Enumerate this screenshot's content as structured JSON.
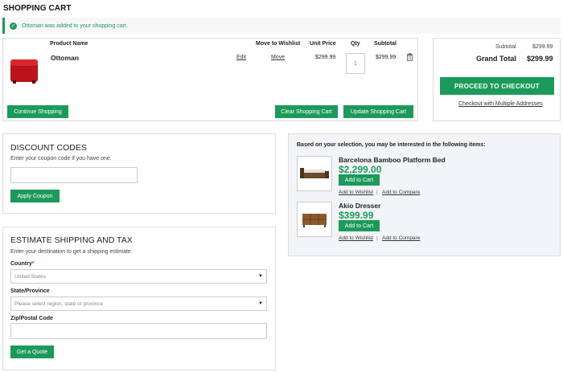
{
  "page": {
    "title": "SHOPPING CART"
  },
  "message": {
    "text": "Ottoman was added to your shopping cart."
  },
  "cart": {
    "headers": {
      "product_name": "Product Name",
      "move_to_wishlist": "Move to Wishlist",
      "unit_price": "Unit Price",
      "qty": "Qty",
      "subtotal": "Subtotal"
    },
    "items": [
      {
        "name": "Ottoman",
        "edit": "Edit",
        "move": "Move",
        "unit_price": "$299.99",
        "qty": "1",
        "subtotal": "$299.99"
      }
    ],
    "buttons": {
      "continue": "Continue Shopping",
      "clear": "Clear Shopping Cart",
      "update": "Update Shopping Cart"
    }
  },
  "summary": {
    "subtotal_label": "Subtotal",
    "subtotal_value": "$299.99",
    "grand_total_label": "Grand Total",
    "grand_total_value": "$299.99",
    "checkout_button": "PROCEED TO CHECKOUT",
    "multi_address_link": "Checkout with Multiple Addresses"
  },
  "discount": {
    "title": "DISCOUNT CODES",
    "hint": "Enter your coupon code if you have one.",
    "coupon_value": "",
    "apply_button": "Apply Coupon"
  },
  "shipping": {
    "title": "ESTIMATE SHIPPING AND TAX",
    "hint": "Enter your destination to get a shipping estimate.",
    "country_label": "Country",
    "country_required": "*",
    "country_value": "United States",
    "state_label": "State/Province",
    "state_placeholder": "Please select region, state or province",
    "zip_label": "Zip/Postal Code",
    "zip_value": "",
    "quote_button": "Get a Quote"
  },
  "crosssell": {
    "heading": "Based on your selection, you may be interested in the following items:",
    "items": [
      {
        "name": "Barcelona Bamboo Platform Bed",
        "price": "$2,299.00",
        "add": "Add to Cart",
        "wishlist": "Add to Wishlist",
        "compare": "Add to Compare",
        "sep": "|"
      },
      {
        "name": "Akio Dresser",
        "price": "$399.99",
        "add": "Add to Cart",
        "wishlist": "Add to Wishlist",
        "compare": "Add to Compare",
        "sep": "|"
      }
    ]
  },
  "icons": {
    "success": "check-circle-icon",
    "delete": "trash-icon",
    "select": "chevron-down-icon"
  },
  "colors": {
    "accent": "#1c9a5a",
    "product": "#c8161d"
  }
}
